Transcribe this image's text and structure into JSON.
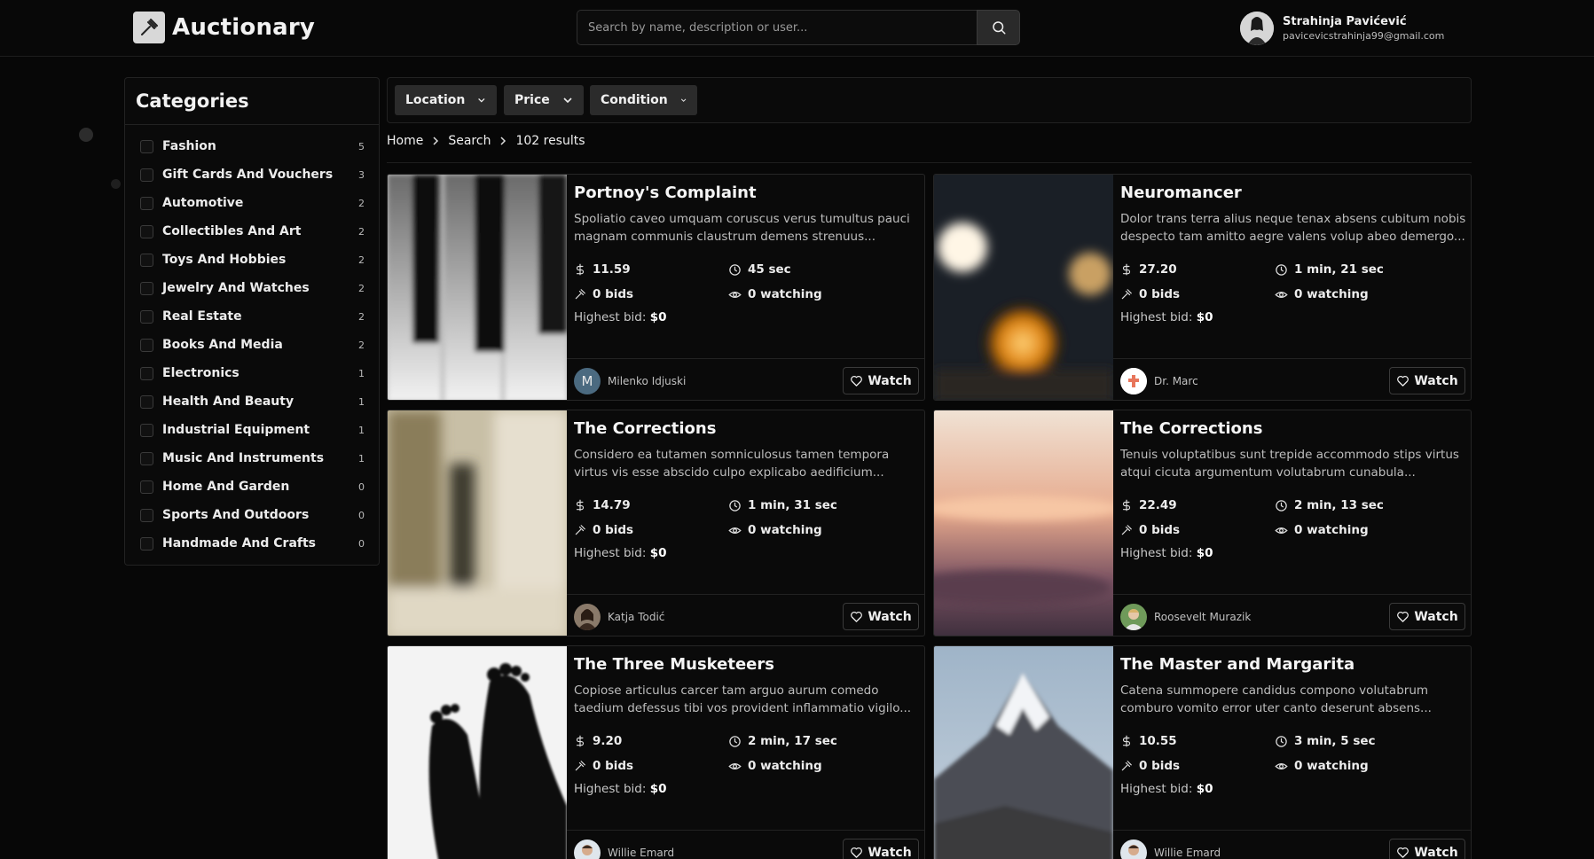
{
  "app": {
    "name": "Auctionary"
  },
  "search": {
    "placeholder": "Search by name, description or user..."
  },
  "user": {
    "name": "Strahinja Pavićević",
    "email": "pavicevicstrahinja99@gmail.com"
  },
  "sidebar": {
    "title": "Categories",
    "categories": [
      {
        "label": "Fashion",
        "count": "5"
      },
      {
        "label": "Gift Cards And Vouchers",
        "count": "3"
      },
      {
        "label": "Automotive",
        "count": "2"
      },
      {
        "label": "Collectibles And Art",
        "count": "2"
      },
      {
        "label": "Toys And Hobbies",
        "count": "2"
      },
      {
        "label": "Jewelry And Watches",
        "count": "2"
      },
      {
        "label": "Real Estate",
        "count": "2"
      },
      {
        "label": "Books And Media",
        "count": "2"
      },
      {
        "label": "Electronics",
        "count": "1"
      },
      {
        "label": "Health And Beauty",
        "count": "1"
      },
      {
        "label": "Industrial Equipment",
        "count": "1"
      },
      {
        "label": "Music And Instruments",
        "count": "1"
      },
      {
        "label": "Home And Garden",
        "count": "0"
      },
      {
        "label": "Sports And Outdoors",
        "count": "0"
      },
      {
        "label": "Handmade And Crafts",
        "count": "0"
      }
    ]
  },
  "filters": [
    {
      "label": "Location"
    },
    {
      "label": "Price"
    },
    {
      "label": "Condition"
    }
  ],
  "breadcrumb": {
    "home": "Home",
    "search": "Search",
    "results": "102 results"
  },
  "labels": {
    "highest_bid": "Highest bid:",
    "watch": "Watch"
  },
  "listings": [
    {
      "title": "Portnoy's Complaint",
      "description": "Spoliatio caveo umquam coruscus verus tumultus pauci magnam communis claustrum demens strenuus...",
      "price": "11.59",
      "time": "45 sec",
      "bids": "0 bids",
      "watching": "0 watching",
      "highest_bid": "$0",
      "seller": "Milenko Idjuski",
      "seller_initial": "M"
    },
    {
      "title": "Neuromancer",
      "description": "Dolor trans terra alius neque tenax absens cubitum nobis despecto tam amitto aegre valens volup abeo demergo...",
      "price": "27.20",
      "time": "1 min, 21 sec",
      "bids": "0 bids",
      "watching": "0 watching",
      "highest_bid": "$0",
      "seller": "Dr. Marc",
      "seller_initial": ""
    },
    {
      "title": "The Corrections",
      "description": "Considero ea tutamen somniculosus tamen tempora virtus vis esse abscido culpo explicabo aedificium...",
      "price": "14.79",
      "time": "1 min, 31 sec",
      "bids": "0 bids",
      "watching": "0 watching",
      "highest_bid": "$0",
      "seller": "Katja Todić",
      "seller_initial": ""
    },
    {
      "title": "The Corrections",
      "description": "Tenuis voluptatibus sunt trepide accommodo stips virtus atqui cicuta argumentum volutabrum cunabula...",
      "price": "22.49",
      "time": "2 min, 13 sec",
      "bids": "0 bids",
      "watching": "0 watching",
      "highest_bid": "$0",
      "seller": "Roosevelt Murazik",
      "seller_initial": ""
    },
    {
      "title": "The Three Musketeers",
      "description": "Copiose articulus carcer tam arguo aurum comedo taedium defessus tibi vos provident inflammatio vigilo...",
      "price": "9.20",
      "time": "2 min, 17 sec",
      "bids": "0 bids",
      "watching": "0 watching",
      "highest_bid": "$0",
      "seller": "Willie Emard",
      "seller_initial": ""
    },
    {
      "title": "The Master and Margarita",
      "description": "Catena summopere candidus compono volutabrum comburo vomito error uter canto deserunt absens...",
      "price": "10.55",
      "time": "3 min, 5 sec",
      "bids": "0 bids",
      "watching": "0 watching",
      "highest_bid": "$0",
      "seller": "Willie Emard",
      "seller_initial": ""
    }
  ]
}
